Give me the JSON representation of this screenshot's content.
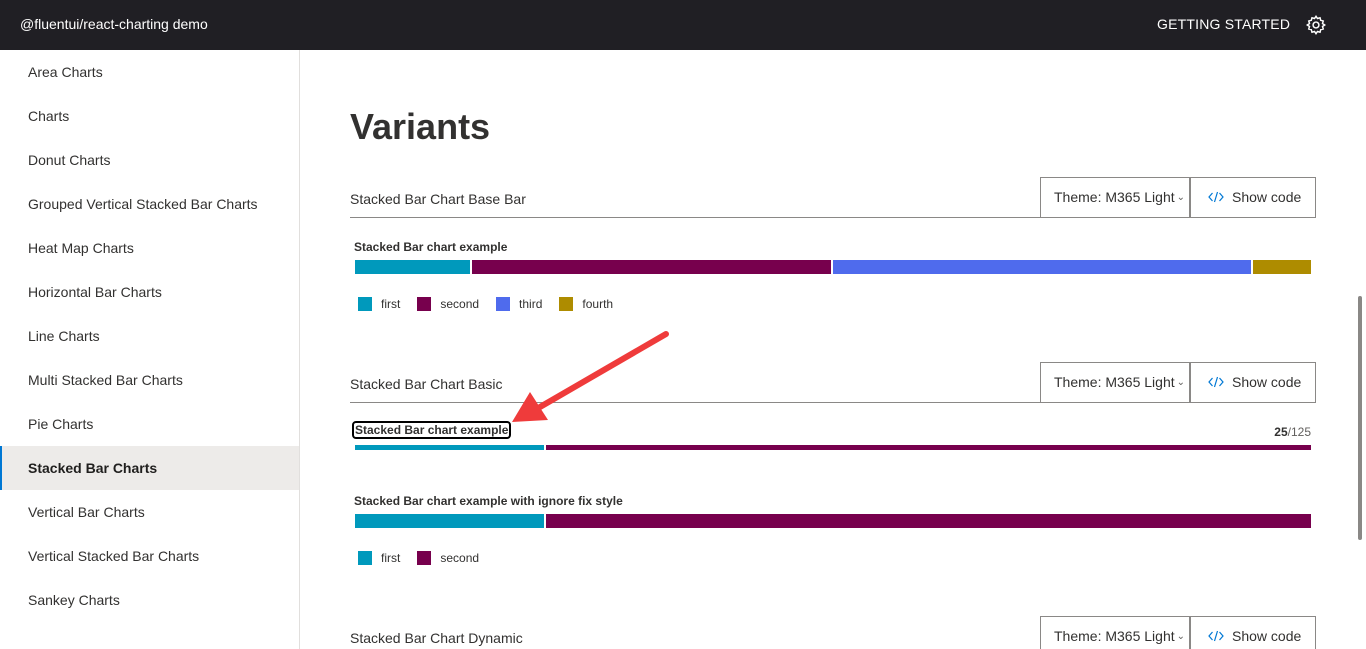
{
  "header": {
    "app_title": "@fluentui/react-charting demo",
    "getting_started": "GETTING STARTED"
  },
  "sidebar": {
    "items": [
      {
        "label": "Area Charts"
      },
      {
        "label": "Charts"
      },
      {
        "label": "Donut Charts"
      },
      {
        "label": "Grouped Vertical Stacked Bar Charts"
      },
      {
        "label": "Heat Map Charts"
      },
      {
        "label": "Horizontal Bar Charts"
      },
      {
        "label": "Line Charts"
      },
      {
        "label": "Multi Stacked Bar Charts"
      },
      {
        "label": "Pie Charts"
      },
      {
        "label": "Stacked Bar Charts"
      },
      {
        "label": "Vertical Bar Charts"
      },
      {
        "label": "Vertical Stacked Bar Charts"
      },
      {
        "label": "Sankey Charts"
      }
    ],
    "selected": "Stacked Bar Charts"
  },
  "main": {
    "title": "Variants",
    "theme_label": "Theme: M365 Light",
    "show_code_label": "Show code",
    "sections": [
      {
        "title": "Stacked Bar Chart Base Bar"
      },
      {
        "title": "Stacked Bar Chart Basic"
      },
      {
        "title": "Stacked Bar Chart Dynamic"
      }
    ],
    "ratio": {
      "numerator": "25",
      "denominator": "/125"
    }
  },
  "chart_data": [
    {
      "type": "bar",
      "title": "Stacked Bar chart example",
      "series": [
        {
          "name": "first",
          "value": 10,
          "color": "#0099bc"
        },
        {
          "name": "second",
          "value": 31,
          "color": "#77004d"
        },
        {
          "name": "third",
          "value": 36,
          "color": "#4f6bed"
        },
        {
          "name": "fourth",
          "value": 5,
          "color": "#ae8c00"
        }
      ]
    },
    {
      "type": "bar",
      "title": "Stacked Bar chart example",
      "series": [
        {
          "name": "first",
          "value": 25,
          "color": "#0099bc"
        },
        {
          "name": "second",
          "value": 100,
          "color": "#77004d"
        }
      ]
    },
    {
      "type": "bar",
      "title": "Stacked Bar chart example with ignore fix style",
      "series": [
        {
          "name": "first",
          "value": 25,
          "color": "#0099bc"
        },
        {
          "name": "second",
          "value": 100,
          "color": "#77004d"
        }
      ]
    }
  ]
}
